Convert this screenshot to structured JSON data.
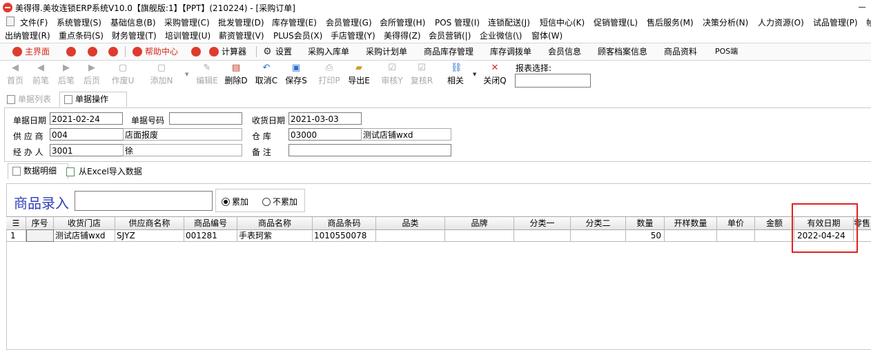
{
  "window": {
    "title": "美得得.美妆连锁ERP系统V10.0【旗舰版:1】【PPT】(210224) - [采购订单]"
  },
  "menu_row1": [
    "文件(F)",
    "系统管理(S)",
    "基础信息(B)",
    "采购管理(C)",
    "批发管理(D)",
    "库存管理(E)",
    "会员管理(G)",
    "会所管理(H)",
    "POS 管理(I)",
    "连锁配送(J)",
    "短信中心(K)",
    "促销管理(L)",
    "售后服务(M)",
    "决策分析(N)",
    "人力资源(O)",
    "试品管理(P)",
    "帧"
  ],
  "menu_row2": [
    "出纳管理(R)",
    "重点条码(S)",
    "财务管理(T)",
    "培训管理(U)",
    "薪资管理(V)",
    "PLUS会员(X)",
    "手店管理(Y)",
    "美得得(Z)",
    "会员营销(|)",
    "企业微信(\\)",
    "窗体(W)"
  ],
  "quickbar": {
    "main": "主界面",
    "help": "帮助中心",
    "calc": "计算器",
    "settings": "设置",
    "links": [
      "采购入库单",
      "采购计划单",
      "商品库存管理",
      "库存调拨单",
      "会员信息",
      "顾客档案信息",
      "商品资料",
      "POS端"
    ]
  },
  "toolbar": {
    "first": "首页",
    "prev": "前笔",
    "next": "后笔",
    "last": "后页",
    "void": "作废U",
    "add": "添加N",
    "edit": "编辑E",
    "delete": "删除D",
    "cancel": "取消C",
    "save": "保存S",
    "print": "打印P",
    "export": "导出E",
    "audit": "审核Y",
    "reaudit": "复核R",
    "related": "相关",
    "close": "关闭Q",
    "report_label": "报表选择:"
  },
  "tabs": {
    "list": "单据列表",
    "operate": "单据操作"
  },
  "form": {
    "date_label": "单据日期",
    "date_value": "2021-02-24",
    "number_label": "单据号码",
    "number_value": "",
    "receive_label": "收货日期",
    "receive_value": "2021-03-03",
    "supplier_label": "供 应 商",
    "supplier_code": "004",
    "supplier_name": "店面报废",
    "warehouse_label": "仓    库",
    "warehouse_code": "03000",
    "warehouse_name": "测试店铺wxd",
    "handler_label": "经 办 人",
    "handler_code": "3001",
    "handler_name": "徐",
    "remark_label": "备    注",
    "remark_value": ""
  },
  "subtabs": {
    "detail": "数据明细",
    "excel": "从Excel导入数据"
  },
  "entry": {
    "label": "商品录入",
    "radio_cumulative": "累加",
    "radio_noncumulative": "不累加"
  },
  "grid": {
    "headers": [
      "序号",
      "收货门店",
      "供应商名称",
      "商品编号",
      "商品名称",
      "商品条码",
      "品类",
      "品牌",
      "分类一",
      "分类二",
      "数量",
      "开样数量",
      "单价",
      "金额",
      "有效日期",
      "零售"
    ],
    "rows": [
      [
        "1",
        "测试店铺wxd",
        "SJYZ",
        "001281",
        "手表珂紫",
        "1010550078",
        "",
        "",
        "",
        "",
        "50",
        "",
        "",
        "",
        "2022-04-24",
        ""
      ]
    ]
  }
}
